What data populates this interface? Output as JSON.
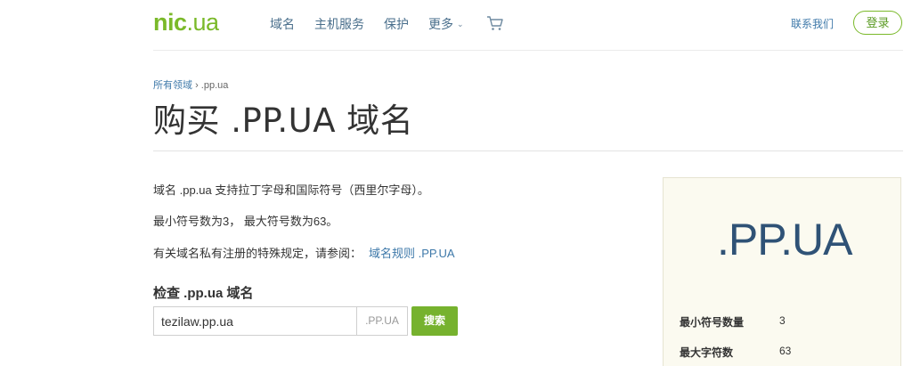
{
  "header": {
    "logo_part1": "nic",
    "logo_part2": ".ua",
    "nav": [
      "域名",
      "主机服务",
      "保护",
      "更多"
    ],
    "contact": "联系我们",
    "login": "登录"
  },
  "breadcrumb": {
    "parent": "所有领域",
    "separator": "›",
    "current": ".pp.ua"
  },
  "page_title": "购买 .PP.UA 域名",
  "info": {
    "line1": "域名 .pp.ua 支持拉丁字母和国际符号（西里尔字母）。",
    "line2": "最小符号数为3， 最大符号数为63。",
    "line3_prefix": "有关域名私有注册的特殊规定，请参阅：",
    "line3_link": "域名规则 .PP.UA"
  },
  "check": {
    "title": "检查 .pp.ua 域名",
    "input_value": "tezilaw.pp.ua",
    "suffix": ".PP.UA",
    "button": "搜索"
  },
  "card": {
    "zone": ".PP.UA",
    "rows": [
      {
        "label": "最小符号数量",
        "value": "3"
      },
      {
        "label": "最大字符数",
        "value": "63"
      }
    ]
  },
  "colors": {
    "brand_green": "#7ab929",
    "link_blue": "#3d78a9",
    "card_bg": "#fbfaf0",
    "zone_text": "#2f5276"
  }
}
